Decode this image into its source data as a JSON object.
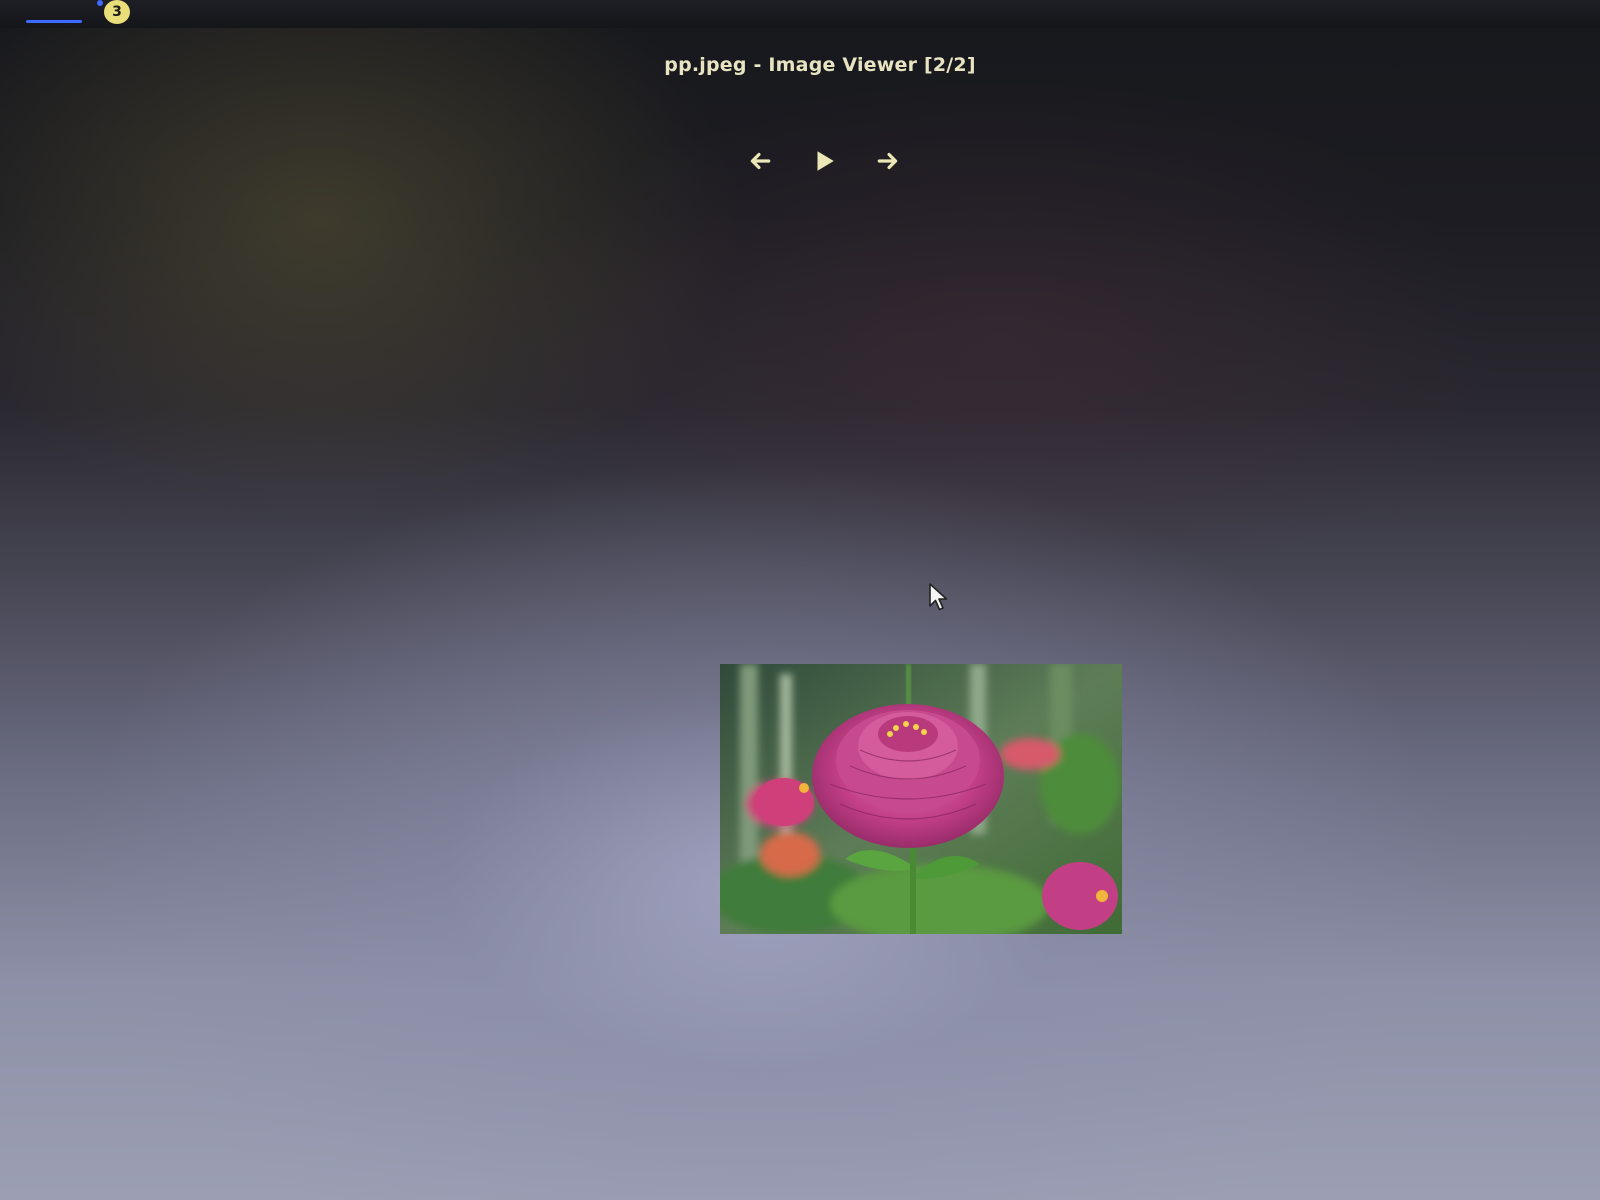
{
  "taskbar": {
    "notification_count": "3",
    "accent_color": "#3d6bff",
    "badge_color": "#e9de7a"
  },
  "viewer": {
    "title": "pp.jpeg - Image Viewer [2/2]",
    "controls": [
      {
        "name": "previous",
        "icon": "arrow-left-icon"
      },
      {
        "name": "slideshow",
        "icon": "play-icon"
      },
      {
        "name": "next",
        "icon": "arrow-right-icon"
      }
    ],
    "control_color": "#ece7b6",
    "image": {
      "subject": "pink zinnia flower photo",
      "colors": {
        "petals": "#c23f86",
        "foliage": "#4f8a3a",
        "background": "#3e5a44"
      }
    }
  },
  "pointer": {
    "icon": "mouse-cursor-icon"
  }
}
